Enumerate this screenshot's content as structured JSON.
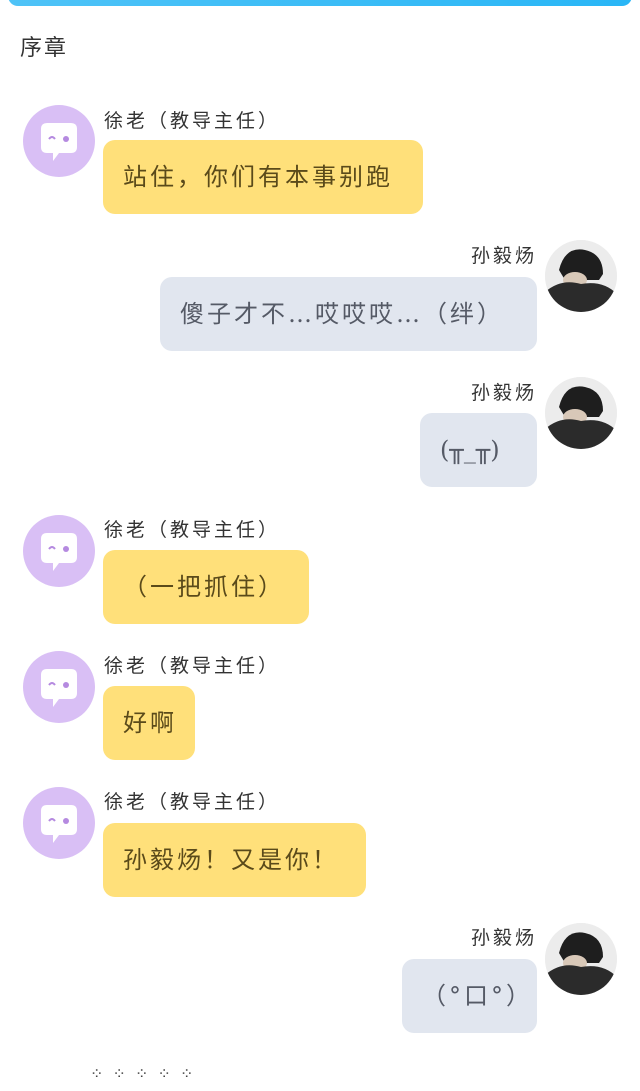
{
  "chapter": {
    "title": "序章"
  },
  "messages": [
    {
      "speaker": "徐老（教导主任）",
      "text": "站住，你们有本事别跑"
    },
    {
      "speaker": "孙毅炀",
      "text": "傻子才不…哎哎哎…（绊）"
    },
    {
      "speaker": "孙毅炀",
      "text": "(╥_╥)"
    },
    {
      "speaker": "徐老（教导主任）",
      "text": "（一把抓住）"
    },
    {
      "speaker": "徐老（教导主任）",
      "text": "好啊"
    },
    {
      "speaker": "徐老（教导主任）",
      "text": "孙毅炀！又是你！"
    },
    {
      "speaker": "孙毅炀",
      "text": "（°口°）"
    }
  ],
  "footer": {
    "dots": "⁘ ⁘ ⁘ ⁘ ⁘"
  },
  "colors": {
    "accent": "#29b6f6",
    "teacher_bubble": "#ffe07a",
    "student_bubble": "#e1e6ef",
    "teacher_avatar": "#d9bff5"
  },
  "icons": {
    "teacher_avatar": "chat-bubble-face-icon",
    "student_avatar": "student-photo-avatar"
  }
}
